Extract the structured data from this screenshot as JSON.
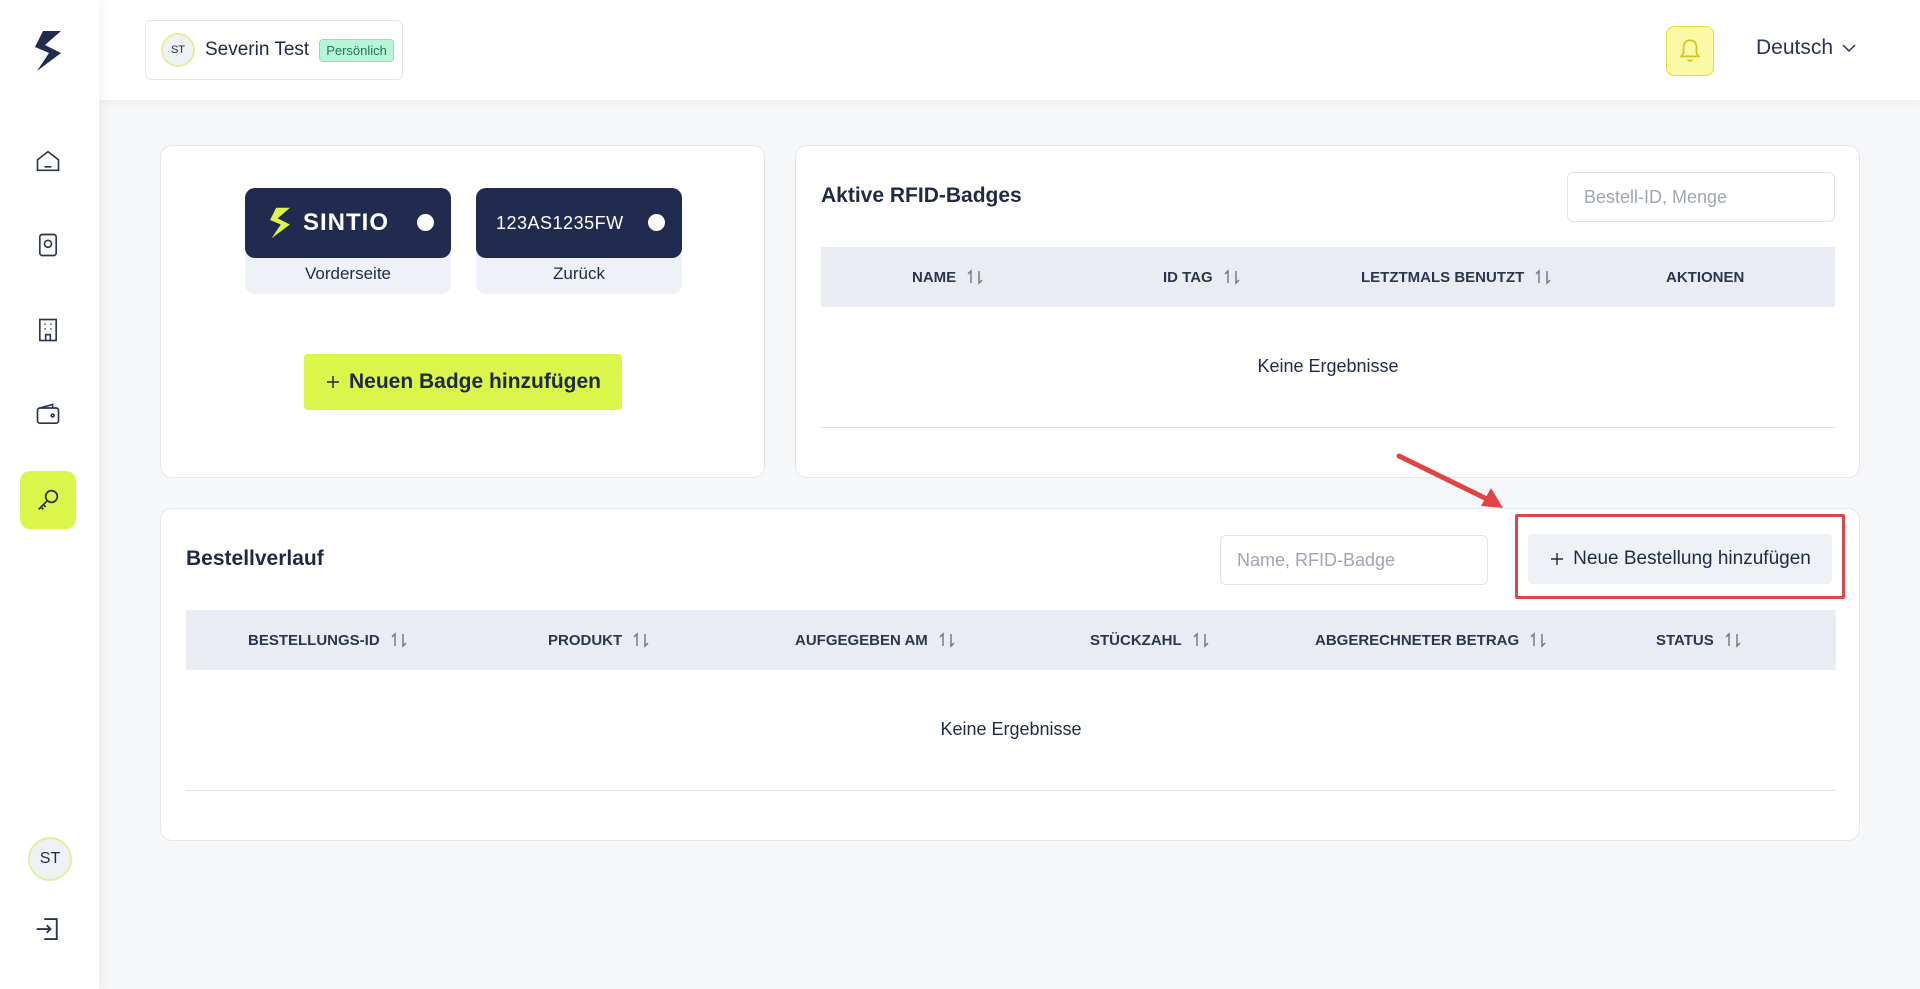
{
  "sidebar": {
    "items": [
      {
        "name": "home",
        "icon": "home-icon",
        "active": false
      },
      {
        "name": "device",
        "icon": "device-icon",
        "active": false
      },
      {
        "name": "building",
        "icon": "building-icon",
        "active": false
      },
      {
        "name": "wallet",
        "icon": "wallet-icon",
        "active": false
      },
      {
        "name": "key",
        "icon": "key-icon",
        "active": true
      }
    ],
    "user_initials": "ST"
  },
  "header": {
    "account": {
      "initials": "ST",
      "name": "Severin Test",
      "badge": "Persönlich"
    },
    "language": "Deutsch"
  },
  "badges_card": {
    "front": {
      "brand": "SINTIO",
      "caption": "Vorderseite"
    },
    "back": {
      "code": "123AS1235FW",
      "caption": "Zurück"
    },
    "add_button": "Neuen Badge hinzufügen"
  },
  "rfid_card": {
    "title": "Aktive RFID-Badges",
    "search_placeholder": "Bestell-ID, Menge",
    "columns": [
      "NAME",
      "ID TAG",
      "LETZTMALS BENUTZT",
      "AKTIONEN"
    ],
    "empty": "Keine Ergebnisse"
  },
  "orders_card": {
    "title": "Bestellverlauf",
    "search_placeholder": "Name, RFID-Badge",
    "add_button": "Neue Bestellung hinzufügen",
    "columns": [
      "BESTELLUNGS-ID",
      "PRODUKT",
      "AUFGEGEBEN AM",
      "STÜCKZAHL",
      "ABGERECHNETER BETRAG",
      "STATUS"
    ],
    "empty": "Keine Ergebnisse"
  },
  "colors": {
    "accent": "#dcf54a",
    "navy": "#212b4f",
    "highlight": "#e04444"
  }
}
